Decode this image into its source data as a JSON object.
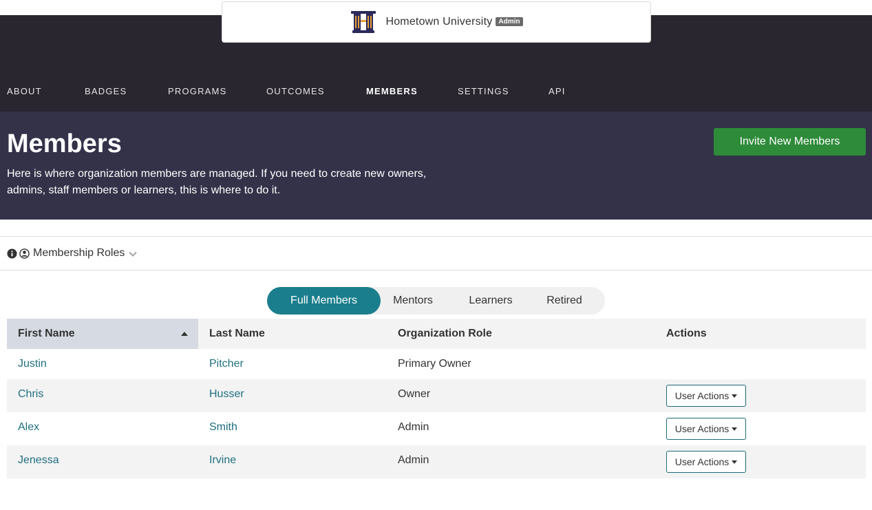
{
  "org": {
    "name": "Hometown University",
    "badge": "Admin",
    "logo_icon": "pillars-logo-icon"
  },
  "nav": {
    "items": [
      {
        "label": "ABOUT"
      },
      {
        "label": "BADGES"
      },
      {
        "label": "PROGRAMS"
      },
      {
        "label": "OUTCOMES"
      },
      {
        "label": "MEMBERS",
        "active": true
      },
      {
        "label": "SETTINGS"
      },
      {
        "label": "API"
      }
    ]
  },
  "hero": {
    "title": "Members",
    "description": "Here is where organization members are managed. If you need to create new owners, admins, staff members or learners, this is where to do it.",
    "invite_label": "Invite New Members"
  },
  "roles": {
    "label": "Membership Roles",
    "icons": [
      "info-icon",
      "user-circle-icon",
      "chevron-down-icon"
    ]
  },
  "tabs": [
    {
      "label": "Full Members",
      "active": true
    },
    {
      "label": "Mentors"
    },
    {
      "label": "Learners"
    },
    {
      "label": "Retired"
    }
  ],
  "table": {
    "headers": [
      "First Name",
      "Last Name",
      "Organization Role",
      "Actions"
    ],
    "sorted_column": "First Name",
    "action_label": "User Actions",
    "rows": [
      {
        "first": "Justin",
        "last": "Pitcher",
        "role": "Primary Owner",
        "has_actions": false
      },
      {
        "first": "Chris",
        "last": "Husser",
        "role": "Owner",
        "has_actions": true
      },
      {
        "first": "Alex",
        "last": "Smith",
        "role": "Admin",
        "has_actions": true
      },
      {
        "first": "Jenessa",
        "last": "Irvine",
        "role": "Admin",
        "has_actions": true
      }
    ]
  },
  "colors": {
    "header_bg": "#29262f",
    "hero_bg": "#333249",
    "accent_orange": "#e8892b",
    "invite_green": "#2e8b3a",
    "tab_teal": "#1b7e8c",
    "link_teal": "#1f6f80"
  }
}
